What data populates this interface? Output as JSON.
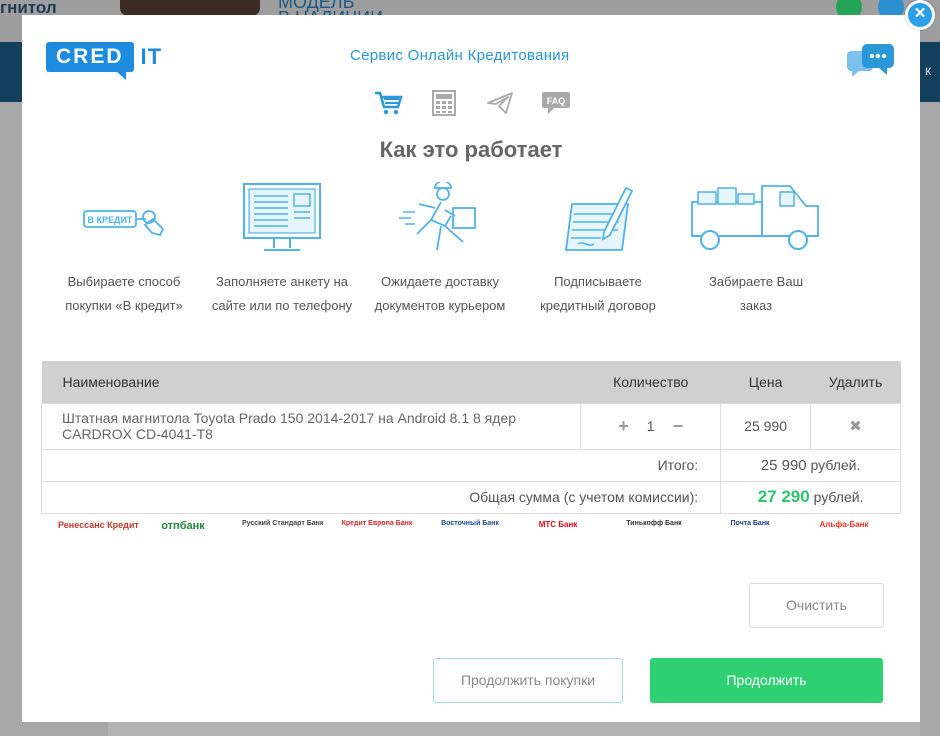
{
  "background": {
    "left_text": "гнитол",
    "availability_line1": "МОДЕЛЬ",
    "availability_line2": "В НАЛИЧИИ",
    "right_fragment": "к"
  },
  "modal": {
    "logo": {
      "cred": "CRED",
      "it": "IT"
    },
    "service_title": "Сервис Онлайн Кредитования",
    "nav_icons": [
      "cart-icon",
      "calculator-icon",
      "paper-plane-icon",
      "faq-icon"
    ],
    "faq_label": "FAQ",
    "how_title": "Как это работает",
    "steps": [
      {
        "icon": "credit-tag-icon",
        "tag": "В КРЕДИТ",
        "line1": "Выбираете способ",
        "line2": "покупки «В кредит»"
      },
      {
        "icon": "monitor-form-icon",
        "line1": "Заполняете анкету на",
        "line2": "сайте или по телефону"
      },
      {
        "icon": "courier-icon",
        "line1": "Ожидаете доставку",
        "line2": "документов курьером"
      },
      {
        "icon": "contract-sign-icon",
        "line1": "Подписываете",
        "line2": "кредитный договор"
      },
      {
        "icon": "delivery-truck-icon",
        "line1": "Забираете Ваш",
        "line2": "заказ"
      }
    ],
    "table": {
      "headers": {
        "name": "Наименование",
        "qty": "Количество",
        "price": "Цена",
        "delete": "Удалить"
      },
      "item": {
        "name": "Штатная магнитола Toyota Prado 150 2014-2017 на Android 8.1 8 ядер CARDROX CD-4041-T8",
        "qty": "1",
        "price": "25 990",
        "plus": "+",
        "minus": "−",
        "remove": "✖"
      },
      "total_label": "Итого:",
      "total_value": "25 990",
      "total_currency": "рублей.",
      "grand_label": "Общая сумма (с учетом комиссии):",
      "grand_value": "27 290",
      "grand_currency": "рублей."
    },
    "banks": [
      {
        "name": "Ренессанс Кредит",
        "color": "#c0392b"
      },
      {
        "name": "отпбанк",
        "color": "#1f8a3b"
      },
      {
        "name": "Русский Стандарт Банк",
        "color": "#444444"
      },
      {
        "name": "Кредит Европа Банк",
        "color": "#d62828"
      },
      {
        "name": "Восточный Банк",
        "color": "#1c4f9c"
      },
      {
        "name": "МТС Банк",
        "color": "#e30611"
      },
      {
        "name": "Тинькофф Банк",
        "color": "#333333"
      },
      {
        "name": "Почта Банк",
        "color": "#1b3c8c"
      },
      {
        "name": "Альфа-Банк",
        "color": "#ef3124"
      }
    ],
    "buttons": {
      "clear": "Очистить",
      "continue_shopping": "Продолжить покупки",
      "continue": "Продолжить"
    },
    "colors": {
      "accent": "#1d8ce0",
      "green": "#2ed072",
      "sum_green": "#2ec46e"
    }
  }
}
